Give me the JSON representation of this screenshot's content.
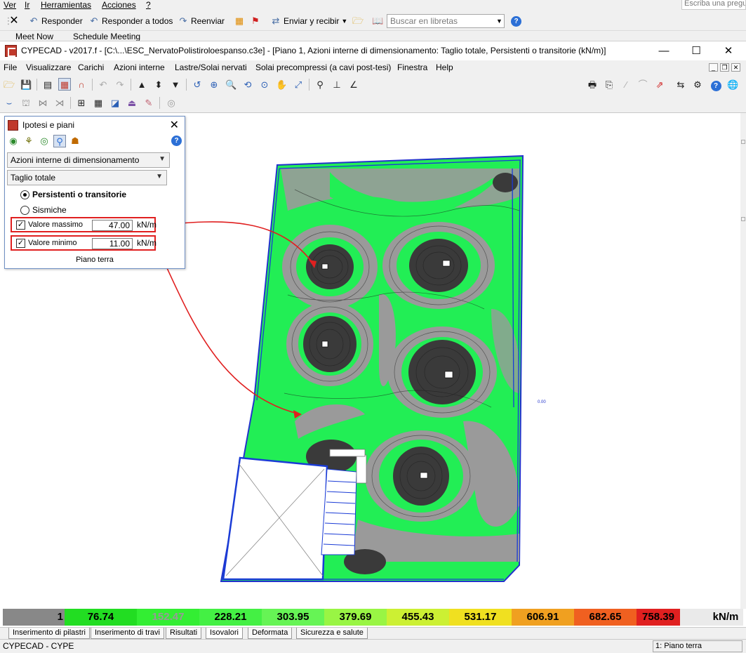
{
  "outlook": {
    "menu": [
      "Ver",
      "Ir",
      "Herramientas",
      "Acciones",
      "?"
    ],
    "ask_box": "Escriba una pregunta",
    "toolbar": {
      "reply": "Responder",
      "reply_all": "Responder a todos",
      "forward": "Reenviar",
      "send_receive": "Enviar y recibir",
      "search_placeholder": "Buscar en libretas"
    },
    "tabs": [
      "Meet Now",
      "Schedule Meeting"
    ]
  },
  "window": {
    "title": "CYPECAD - v2017.f - [C:\\...\\ESC_NervatoPolistiroloespanso.c3e] - [Piano 1, Azioni interne di dimensionamento: Taglio totale, Persistenti o transitorie (kN/m)]",
    "controls": [
      "—",
      "☐",
      "✕"
    ]
  },
  "menubar": [
    "File",
    "Visualizzare",
    "Carichi",
    "Azioni interne",
    "Lastre/Solai nervati",
    "Solai precompressi (a cavi post-tesi)",
    "Finestra",
    "Help"
  ],
  "panel": {
    "title": "Ipotesi e piani",
    "combo_1": "Azioni interne di dimensionamento",
    "combo_2": "Taglio totale",
    "radio_persistent": "Persistenti o transitorie",
    "radio_seismic": "Sismiche",
    "max": {
      "label": "Valore massimo",
      "value": "47.00",
      "unit": "kN/m",
      "checked": true
    },
    "min": {
      "label": "Valore minimo",
      "value": "11.00",
      "unit": "kN/m",
      "checked": true
    },
    "footer": "Piano terra"
  },
  "drawing": {
    "small_label": "0.00"
  },
  "legend": {
    "values": [
      "1",
      "76.74",
      "152.47",
      "228.21",
      "303.95",
      "379.69",
      "455.43",
      "531.17",
      "606.91",
      "682.65",
      "758.39"
    ],
    "unit": "kN/m",
    "colors": [
      "#888888",
      "#22dd22",
      "#33ee33",
      "#44f044",
      "#66f455",
      "#99f544",
      "#ccf033",
      "#f0e020",
      "#f0a020",
      "#f06020",
      "#e02020"
    ],
    "text_colors": [
      "#000000",
      "#000000",
      "#999999",
      "#000000",
      "#000000",
      "#000000",
      "#000000",
      "#000000",
      "#000000",
      "#000000",
      "#000000"
    ]
  },
  "bottom_tabs": [
    "Inserimento di pilastri",
    "Inserimento di travi",
    "Risultati",
    "Isovalori",
    "Deformata",
    "Sicurezza e salute"
  ],
  "active_tab": "Isovalori",
  "status": {
    "left": "CYPECAD - CYPE",
    "right": "1: Piano terra"
  }
}
